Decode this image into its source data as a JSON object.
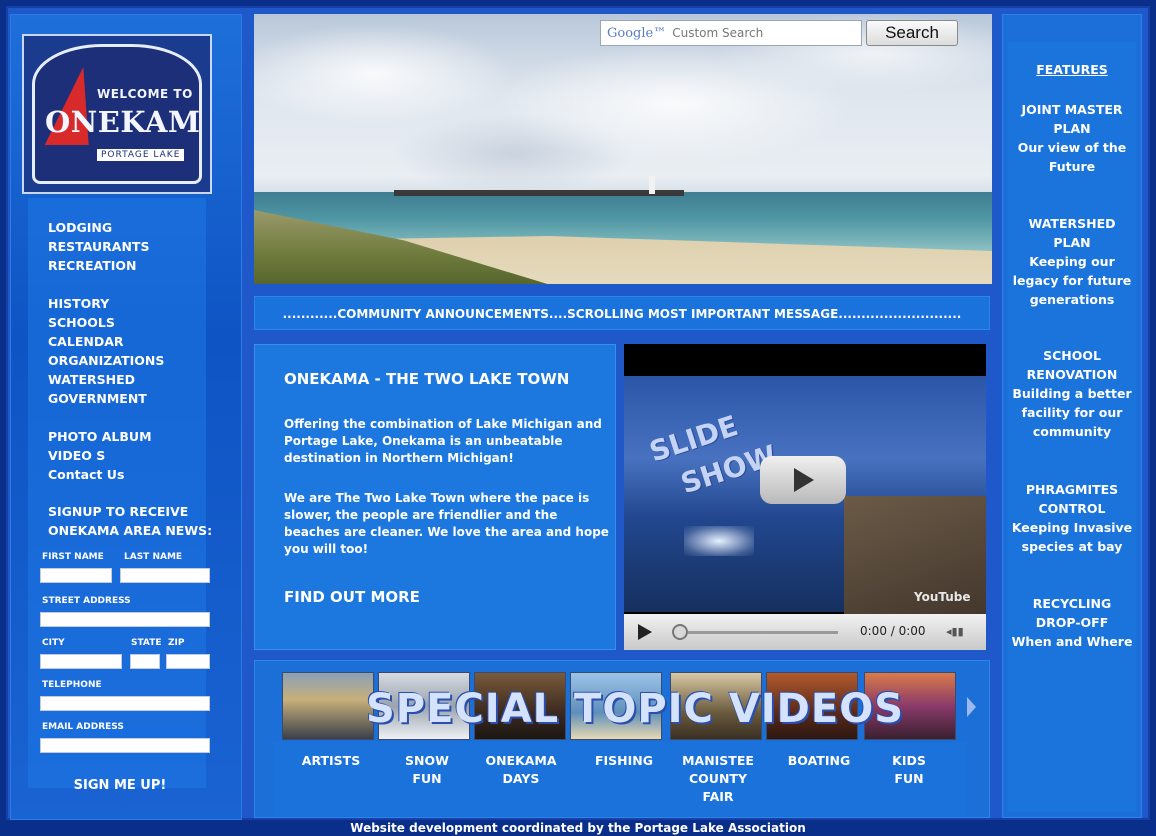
{
  "logo": {
    "welcome": "WELCOME TO",
    "name": "ONEKAMA",
    "tagline": "PORTAGE LAKE"
  },
  "nav": {
    "group1": [
      "LODGING",
      "RESTAURANTS",
      "RECREATION"
    ],
    "group2": [
      "HISTORY",
      "SCHOOLS",
      "CALENDAR",
      "ORGANIZATIONS",
      "WATERSHED",
      "GOVERNMENT"
    ],
    "group3": [
      "PHOTO ALBUM",
      "VIDEO S",
      "Contact Us"
    ]
  },
  "signup": {
    "title_line1": "SIGNUP TO RECEIVE",
    "title_line2": "ONEKAMA AREA NEWS:",
    "first_name": "FIRST NAME",
    "last_name": "LAST NAME",
    "street": "STREET ADDRESS",
    "city": "CITY",
    "state": "STATE",
    "zip": "ZIP",
    "telephone": "TELEPHONE",
    "email": "EMAIL ADDRESS",
    "button": "SIGN ME UP!"
  },
  "search": {
    "brand": "Google™",
    "placeholder": "Custom Search",
    "button": "Search"
  },
  "announcement": "............COMMUNITY ANNOUNCEMENTS....SCROLLING MOST IMPORTANT MESSAGE...........................",
  "intro": {
    "title": "ONEKAMA - THE TWO LAKE TOWN",
    "para1": "Offering the combination of Lake Michigan and Portage Lake, Onekama is an unbeatable destination in Northern Michigan!",
    "para2": "We are The Two Lake Town where the pace is slower, the people are friendlier and the beaches are cleaner. We love the area and hope you will too!",
    "more": "FIND OUT MORE"
  },
  "video": {
    "overlay_line1": "SLIDE",
    "overlay_line2": "SHOW",
    "brand": "YouTube",
    "time": "0:00 / 0:00",
    "progress": 0
  },
  "topic_videos": {
    "title": "SPECIAL TOPIC VIDEOS",
    "items": [
      {
        "line1": "ARTISTS",
        "line2": "",
        "line3": ""
      },
      {
        "line1": "SNOW",
        "line2": "FUN",
        "line3": ""
      },
      {
        "line1": "ONEKAMA",
        "line2": "DAYS",
        "line3": ""
      },
      {
        "line1": "FISHING",
        "line2": "",
        "line3": ""
      },
      {
        "line1": "MANISTEE",
        "line2": "COUNTY",
        "line3": "FAIR"
      },
      {
        "line1": "BOATING",
        "line2": "",
        "line3": ""
      },
      {
        "line1": "KIDS",
        "line2": "FUN",
        "line3": ""
      }
    ]
  },
  "features": {
    "heading": "FEATURES",
    "items": [
      {
        "title": "JOINT MASTER PLAN",
        "desc": "Our view of the Future"
      },
      {
        "title": "WATERSHED PLAN",
        "desc": "Keeping our legacy for future generations"
      },
      {
        "title": "SCHOOL RENOVATION",
        "desc": "Building a better facility for our community"
      },
      {
        "title": "PHRAGMITES CONTROL",
        "desc": "Keeping Invasive species at bay"
      },
      {
        "title": "RECYCLING DROP-OFF",
        "desc": "When and Where"
      }
    ]
  },
  "footer": "Website development coordinated by the Portage Lake Association"
}
